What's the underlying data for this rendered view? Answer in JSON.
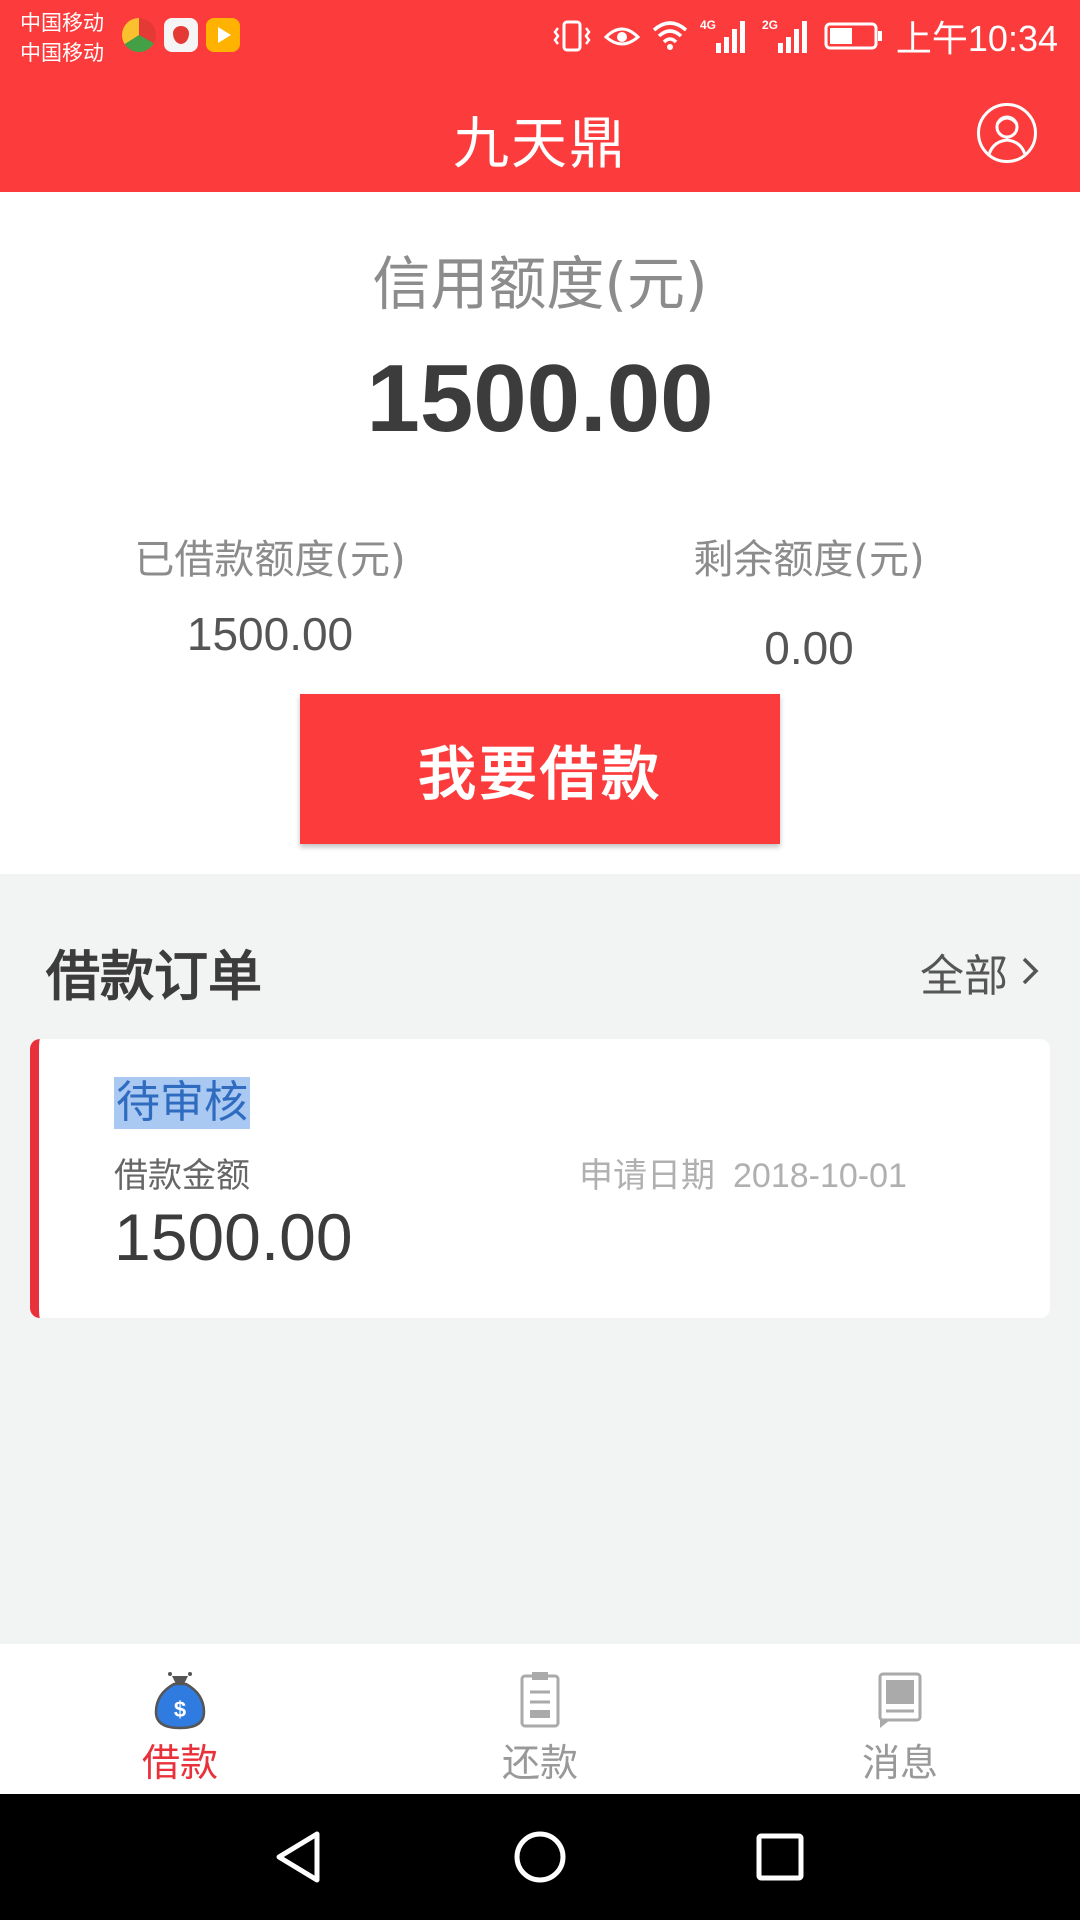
{
  "status_bar": {
    "carrier_1": "中国移动",
    "carrier_2": "中国移动",
    "network_1": "4G",
    "network_2": "2G",
    "time": "上午10:34",
    "icons": [
      "vibrate-icon",
      "eye-comfort-icon",
      "wifi-icon",
      "signal-4g-icon",
      "signal-2g-icon",
      "battery-icon"
    ]
  },
  "header": {
    "title": "九天鼎",
    "profile_icon": "user-profile-icon"
  },
  "credit": {
    "label": "信用额度(元)",
    "value": "1500.00",
    "borrowed_label": "已借款额度(元)",
    "borrowed_value": "1500.00",
    "remaining_label": "剩余额度(元)",
    "remaining_value": "0.00",
    "borrow_button": "我要借款"
  },
  "orders": {
    "title": "借款订单",
    "all_label": "全部",
    "items": [
      {
        "status": "待审核",
        "amount_label": "借款金额",
        "date_label": "申请日期",
        "date": "2018-10-01",
        "amount": "1500.00"
      }
    ]
  },
  "tabs": [
    {
      "label": "借款",
      "icon": "money-bag-icon",
      "active": true
    },
    {
      "label": "还款",
      "icon": "clipboard-icon",
      "active": false
    },
    {
      "label": "消息",
      "icon": "message-icon",
      "active": false
    }
  ],
  "colors": {
    "brand_red": "#fc3c3c",
    "active_tab": "#e8313a",
    "inactive_tab": "#999999",
    "background": "#f2f3f3"
  }
}
